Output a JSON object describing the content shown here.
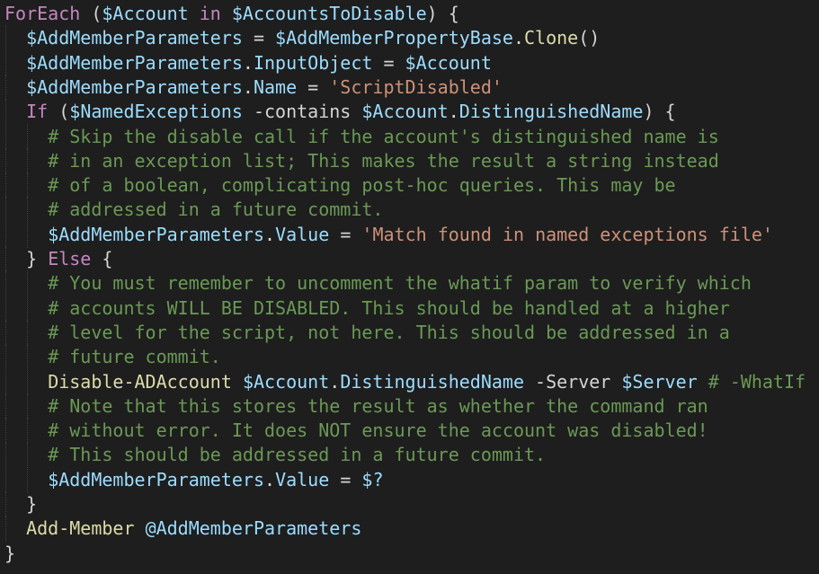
{
  "editor": {
    "colors": {
      "background": "#1e1e1e",
      "keyword": "#c586c0",
      "variable": "#9cdcfe",
      "method": "#dcdcaa",
      "string": "#ce9178",
      "comment": "#6a9955",
      "text": "#d4d4d4"
    },
    "lines": [
      {
        "indent": 0,
        "tokens": [
          [
            "kw",
            "ForEach"
          ],
          [
            "text",
            " ("
          ],
          [
            "var",
            "$Account"
          ],
          [
            "kw",
            " in "
          ],
          [
            "var",
            "$AccountsToDisable"
          ],
          [
            "text",
            ") {"
          ]
        ]
      },
      {
        "indent": 1,
        "tokens": [
          [
            "var",
            "$AddMemberParameters"
          ],
          [
            "op",
            " = "
          ],
          [
            "var",
            "$AddMemberPropertyBase"
          ],
          [
            "text",
            "."
          ],
          [
            "method",
            "Clone"
          ],
          [
            "text",
            "()"
          ]
        ]
      },
      {
        "indent": 1,
        "tokens": [
          [
            "var",
            "$AddMemberParameters"
          ],
          [
            "text",
            "."
          ],
          [
            "prop",
            "InputObject"
          ],
          [
            "op",
            " = "
          ],
          [
            "var",
            "$Account"
          ]
        ]
      },
      {
        "indent": 1,
        "tokens": [
          [
            "var",
            "$AddMemberParameters"
          ],
          [
            "text",
            "."
          ],
          [
            "prop",
            "Name"
          ],
          [
            "op",
            " = "
          ],
          [
            "str",
            "'ScriptDisabled'"
          ]
        ]
      },
      {
        "indent": 1,
        "tokens": [
          [
            "kw",
            "If"
          ],
          [
            "text",
            " ("
          ],
          [
            "var",
            "$NamedExceptions"
          ],
          [
            "op",
            " -contains "
          ],
          [
            "var",
            "$Account"
          ],
          [
            "text",
            "."
          ],
          [
            "prop",
            "DistinguishedName"
          ],
          [
            "text",
            ") {"
          ]
        ]
      },
      {
        "indent": 2,
        "tokens": [
          [
            "com",
            "# Skip the disable call if the account's distinguished name is"
          ]
        ]
      },
      {
        "indent": 2,
        "tokens": [
          [
            "com",
            "# in an exception list; This makes the result a string instead"
          ]
        ]
      },
      {
        "indent": 2,
        "tokens": [
          [
            "com",
            "# of a boolean, complicating post-hoc queries. This may be"
          ]
        ]
      },
      {
        "indent": 2,
        "tokens": [
          [
            "com",
            "# addressed in a future commit."
          ]
        ]
      },
      {
        "indent": 2,
        "tokens": [
          [
            "var",
            "$AddMemberParameters"
          ],
          [
            "text",
            "."
          ],
          [
            "prop",
            "Value"
          ],
          [
            "op",
            " = "
          ],
          [
            "str",
            "'Match found in named exceptions file'"
          ]
        ]
      },
      {
        "indent": 1,
        "tokens": [
          [
            "text",
            "} "
          ],
          [
            "kw",
            "Else"
          ],
          [
            "text",
            " {"
          ]
        ]
      },
      {
        "indent": 2,
        "tokens": [
          [
            "com",
            "# You must remember to uncomment the whatif param to verify which"
          ]
        ]
      },
      {
        "indent": 2,
        "tokens": [
          [
            "com",
            "# accounts WILL BE DISABLED. This should be handled at a higher"
          ]
        ]
      },
      {
        "indent": 2,
        "tokens": [
          [
            "com",
            "# level for the script, not here. This should be addressed in a"
          ]
        ]
      },
      {
        "indent": 2,
        "tokens": [
          [
            "com",
            "# future commit."
          ]
        ]
      },
      {
        "indent": 2,
        "tokens": [
          [
            "fn",
            "Disable-ADAccount"
          ],
          [
            "text",
            " "
          ],
          [
            "var",
            "$Account"
          ],
          [
            "text",
            "."
          ],
          [
            "prop",
            "DistinguishedName"
          ],
          [
            "param",
            " -Server "
          ],
          [
            "var",
            "$Server"
          ],
          [
            "com",
            " # -WhatIf"
          ]
        ]
      },
      {
        "indent": 2,
        "tokens": [
          [
            "com",
            "# Note that this stores the result as whether the command ran"
          ]
        ]
      },
      {
        "indent": 2,
        "tokens": [
          [
            "com",
            "# without error. It does NOT ensure the account was disabled!"
          ]
        ]
      },
      {
        "indent": 2,
        "tokens": [
          [
            "com",
            "# This should be addressed in a future commit."
          ]
        ]
      },
      {
        "indent": 2,
        "tokens": [
          [
            "var",
            "$AddMemberParameters"
          ],
          [
            "text",
            "."
          ],
          [
            "prop",
            "Value"
          ],
          [
            "op",
            " = "
          ],
          [
            "var",
            "$?"
          ]
        ]
      },
      {
        "indent": 1,
        "tokens": [
          [
            "text",
            "}"
          ]
        ]
      },
      {
        "indent": 1,
        "tokens": [
          [
            "fn",
            "Add-Member"
          ],
          [
            "text",
            " "
          ],
          [
            "var",
            "@AddMemberParameters"
          ]
        ]
      },
      {
        "indent": 0,
        "tokens": [
          [
            "text",
            "}"
          ]
        ]
      }
    ]
  }
}
